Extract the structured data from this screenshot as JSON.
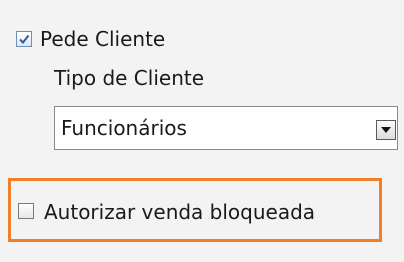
{
  "form": {
    "pede_cliente": {
      "label": "Pede Cliente",
      "checked": true
    },
    "tipo_cliente": {
      "label": "Tipo de Cliente",
      "selected": "Funcionários"
    },
    "autorizar_venda": {
      "label": "Autorizar venda bloqueada",
      "checked": false
    }
  },
  "colors": {
    "highlight_border": "#f07f2a",
    "check_mark": "#2b5ea5"
  },
  "icons": {
    "checkmark": "checkmark-icon",
    "dropdown": "chevron-down-icon"
  }
}
